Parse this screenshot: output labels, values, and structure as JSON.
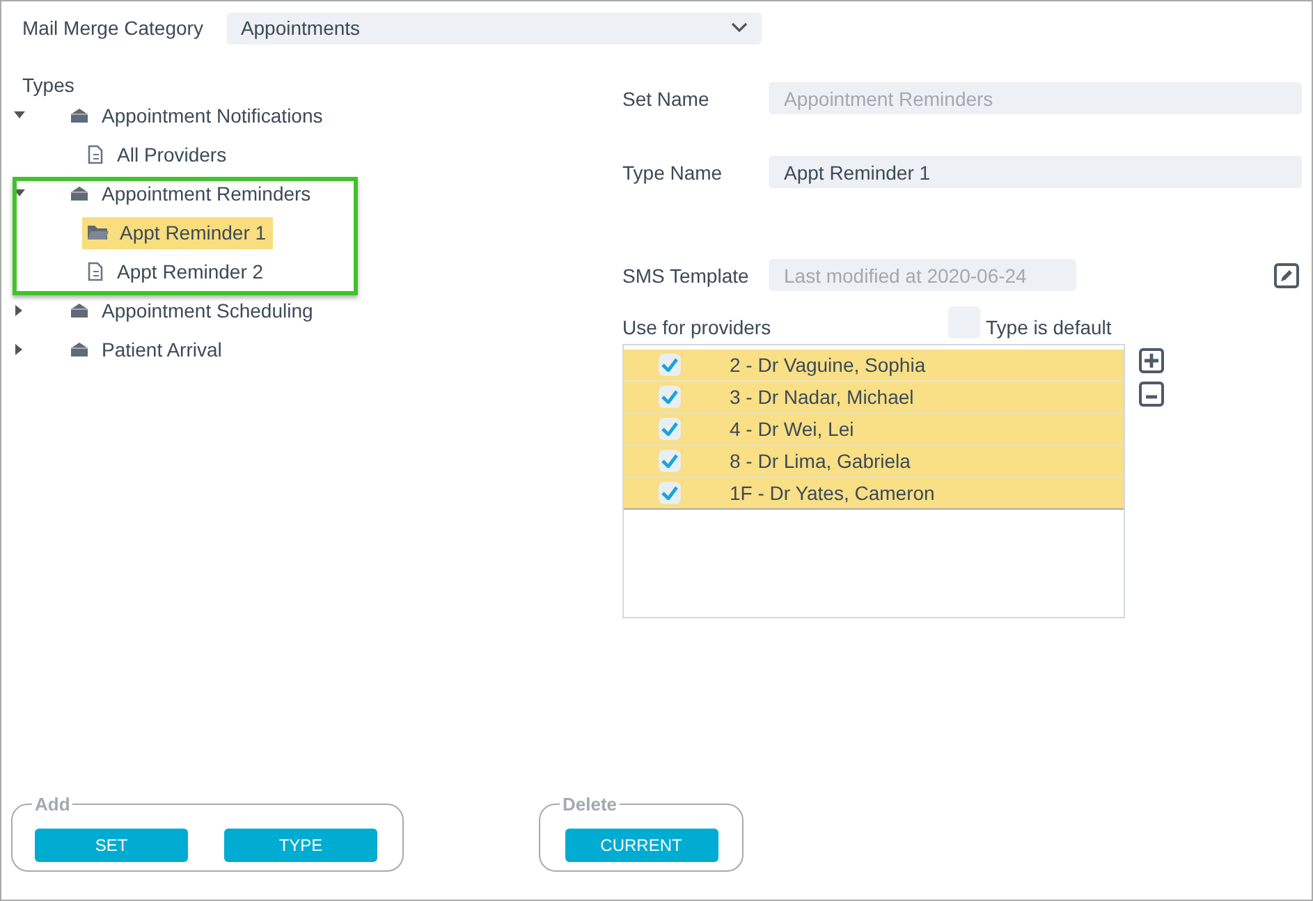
{
  "category": {
    "label": "Mail Merge Category",
    "value": "Appointments"
  },
  "types": {
    "heading": "Types",
    "items": [
      {
        "label": "Appointment Notifications",
        "kind": "set",
        "expanded": true,
        "selected": false,
        "children": [
          {
            "label": "All Providers",
            "kind": "type",
            "selected": false
          }
        ]
      },
      {
        "label": "Appointment Reminders",
        "kind": "set",
        "expanded": true,
        "selected": false,
        "children": [
          {
            "label": "Appt Reminder 1",
            "kind": "type",
            "selected": true
          },
          {
            "label": "Appt Reminder 2",
            "kind": "type",
            "selected": false
          }
        ]
      },
      {
        "label": "Appointment Scheduling",
        "kind": "set",
        "expanded": false,
        "selected": false
      },
      {
        "label": "Patient Arrival",
        "kind": "set",
        "expanded": false,
        "selected": false
      }
    ]
  },
  "set_name": {
    "label": "Set Name",
    "placeholder": "Appointment Reminders"
  },
  "type_name": {
    "label": "Type Name",
    "value": "Appt Reminder 1"
  },
  "sms_template": {
    "label": "SMS Template",
    "placeholder": "Last modified at 2020-06-24"
  },
  "providers": {
    "label": "Use for providers",
    "default_label": "Type is default",
    "type_is_default": false,
    "rows": [
      {
        "name": "2 - Dr Vaguine, Sophia",
        "checked": true
      },
      {
        "name": "3 - Dr Nadar, Michael",
        "checked": true
      },
      {
        "name": "4 - Dr Wei, Lei",
        "checked": true
      },
      {
        "name": "8 - Dr Lima, Gabriela",
        "checked": true
      },
      {
        "name": "1F - Dr Yates, Cameron",
        "checked": true
      }
    ]
  },
  "add_group": {
    "legend": "Add",
    "buttons": [
      "SET",
      "TYPE"
    ]
  },
  "delete_group": {
    "legend": "Delete",
    "buttons": [
      "CURRENT"
    ]
  }
}
